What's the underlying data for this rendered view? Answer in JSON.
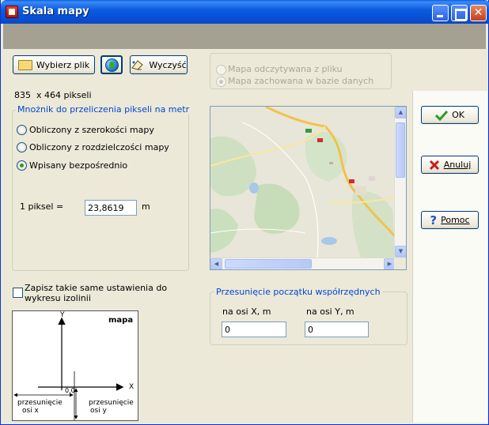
{
  "window": {
    "title": "Skala mapy"
  },
  "toolbar": {
    "select_file_label": "Wybierz plik",
    "clear_label": "Wyczyść"
  },
  "source": {
    "options": [
      {
        "label": "Mapa odczytywana z pliku",
        "selected": false
      },
      {
        "label": "Mapa zachowana w bazie danych",
        "selected": true
      }
    ]
  },
  "image_size": {
    "width": "835",
    "height": "464",
    "unit": "pikseli",
    "separator": "x"
  },
  "multiplier": {
    "legend": "Mnożnik  do przeliczenia pikseli na metr",
    "options": [
      {
        "label": "Obliczony z szerokości mapy",
        "selected": false
      },
      {
        "label": "Obliczony z rozdzielczości mapy",
        "selected": false
      },
      {
        "label": "Wpisany bezpośrednio",
        "selected": true
      }
    ],
    "pixel_label": "1 piksel =",
    "value": "23,8619",
    "unit": "m"
  },
  "save_settings": {
    "label_line1": "Zapisz takie same ustawienia  do",
    "label_line2": "wykresu izolinii",
    "checked": false
  },
  "diagram": {
    "title": "mapa",
    "axis_y": "Y",
    "axis_x": "X",
    "origin": "0,0",
    "shift_x_line1": "przesunięcie",
    "shift_x_line2": "osi x",
    "shift_y_line1": "przesunięcie",
    "shift_y_line2": "osi y"
  },
  "offset": {
    "legend": "Przesunięcie początku współrzędnych",
    "x_label": "na osi X, m",
    "x_value": "0",
    "y_label": "na osi Y, m",
    "y_value": "0"
  },
  "buttons": {
    "ok": "OK",
    "cancel": "Anuluj",
    "help": "Pomoc"
  },
  "colors": {
    "title_bar": "#0a5fe3",
    "accent_text": "#0046d5",
    "ok_check": "#2b9a2b",
    "cancel_x": "#c81e1e",
    "help_q": "#1a57c8"
  }
}
